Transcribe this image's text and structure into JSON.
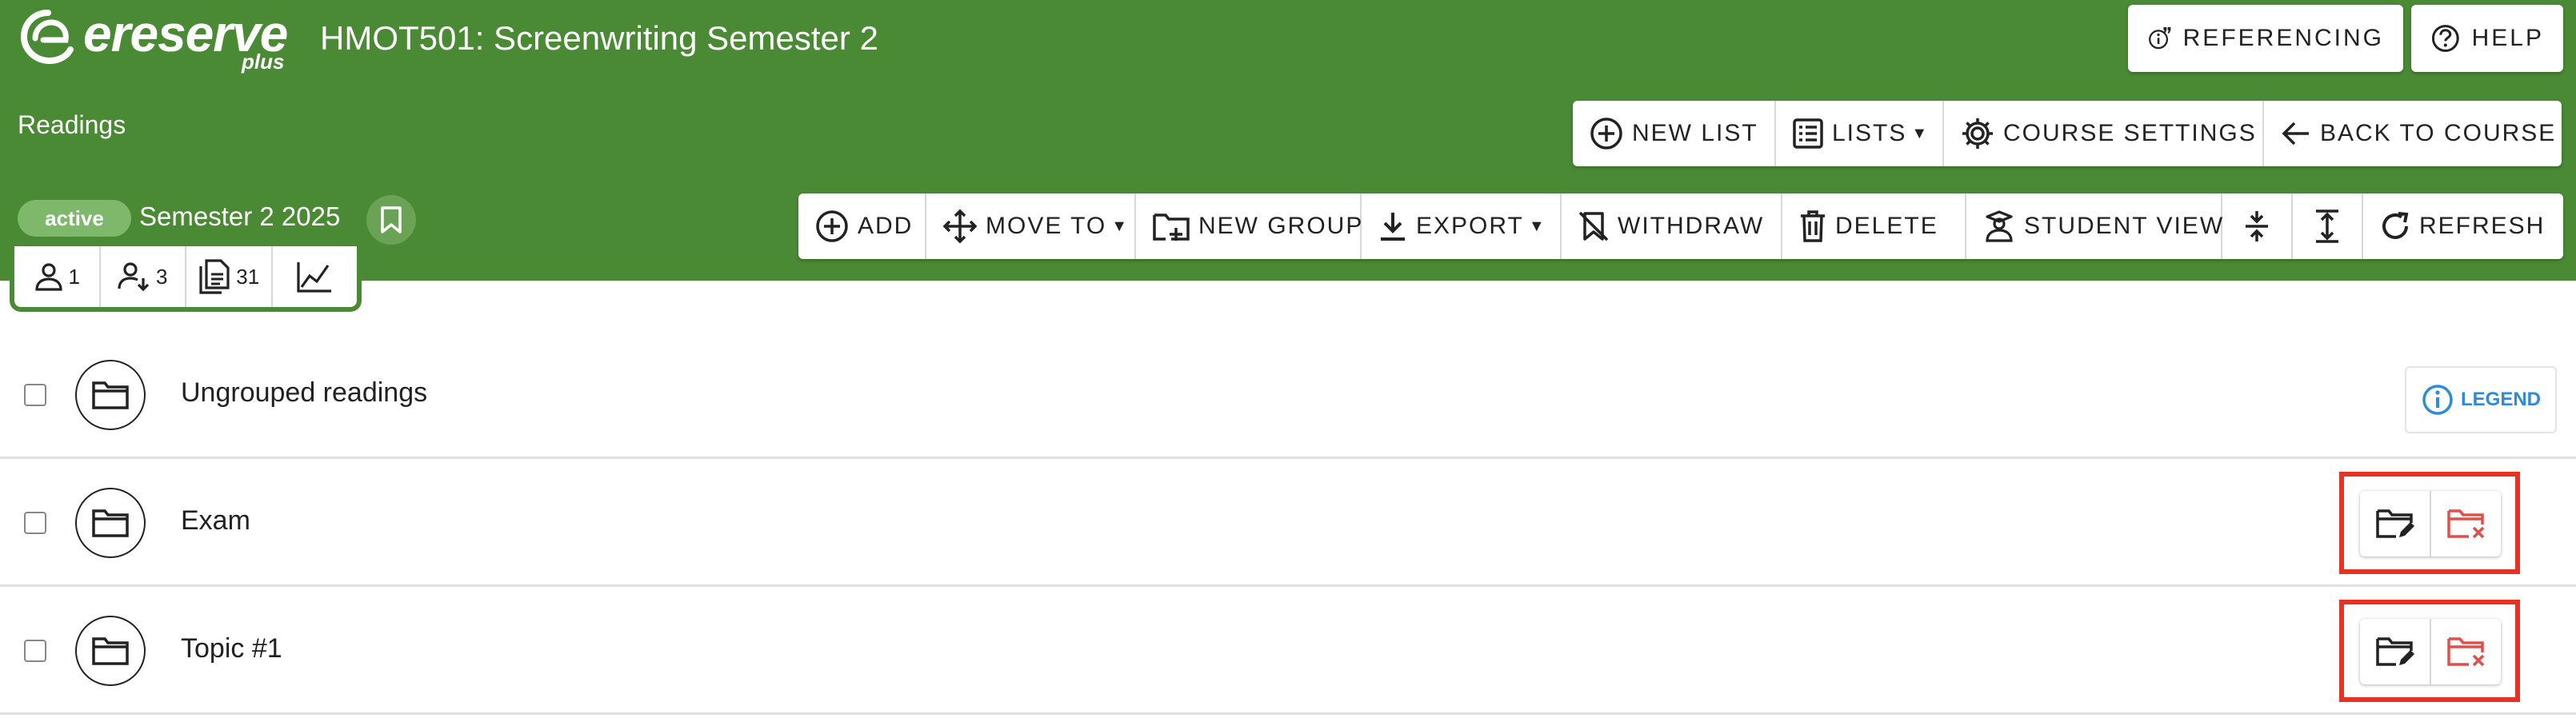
{
  "app": {
    "brand": "ereserve",
    "brand_suffix": "plus"
  },
  "header": {
    "course_title": "HMOT501: Screenwriting Semester 2",
    "section": "Readings",
    "referencing_label": "REFERENCING",
    "help_label": "HELP"
  },
  "list_toolbar": {
    "new_list": "NEW LIST",
    "lists": "LISTS",
    "course_settings": "COURSE SETTINGS",
    "back_to_course": "BACK TO COURSE"
  },
  "status": {
    "badge": "active",
    "semester": "Semester 2 2025"
  },
  "stats": {
    "owners": "1",
    "students": "3",
    "readings": "31"
  },
  "toolbar": {
    "add": "ADD",
    "move_to": "MOVE TO",
    "new_group": "NEW GROUP",
    "export": "EXPORT",
    "withdraw": "WITHDRAW",
    "delete": "DELETE",
    "student_view": "STUDENT VIEW",
    "refresh": "REFRESH"
  },
  "groups": [
    {
      "label": "Ungrouped readings"
    },
    {
      "label": "Exam"
    },
    {
      "label": "Topic #1"
    }
  ],
  "legend_label": "LEGEND",
  "colors": {
    "header_bg": "#4a8a34",
    "active_badge": "#7eb86a",
    "highlight": "#e53222",
    "legend": "#2f8ad8",
    "delete_icon": "#e0504a"
  }
}
